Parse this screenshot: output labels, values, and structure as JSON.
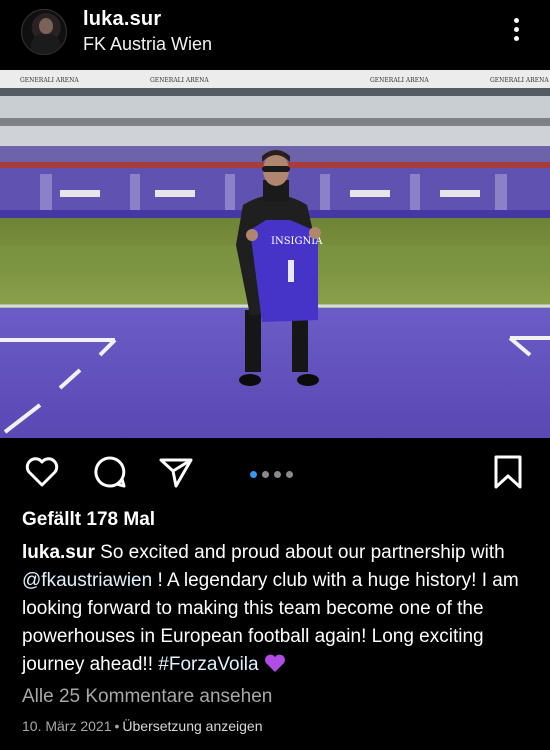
{
  "post": {
    "username": "luka.sur",
    "location": "FK Austria Wien",
    "likes": "Gefällt 178 Mal",
    "caption_user": "luka.sur",
    "caption_part1": " So excited and proud about our partnership with ",
    "mention": "@fkaustriawien",
    "caption_part2": " ! A legendary club with a huge history! I am looking forward to making this team become one of the powerhouses in European football again! Long exciting journey ahead!! ",
    "hashtag": "#ForzaVoila",
    "view_comments": "Alle 25 Kommentare ansehen",
    "date": "10. März 2021",
    "separator": "•",
    "translate": "Übersetzung anzeigen"
  },
  "carousel": {
    "count": 4,
    "active_index": 0
  },
  "photo": {
    "banner_texts": [
      "GENERALI ARENA",
      "GENERALI ARENA",
      "GENERALI ARENA",
      "GENERALI ARENA"
    ],
    "jersey_text": "INSIGNIA",
    "jersey_number": "1"
  },
  "icons": {
    "like": "heart-outline-icon",
    "comment": "comment-bubble-icon",
    "share": "paper-plane-icon",
    "save": "bookmark-icon",
    "more": "more-vertical-icon",
    "emoji": "purple-heart-emoji"
  },
  "colors": {
    "background": "#000000",
    "text": "#ffffff",
    "muted": "#a8a8a8",
    "accent_dot": "#3897f0",
    "pitch_purple": "#6a58c0",
    "grass": "#6f8a3a",
    "emoji_purple": "#b04de6"
  }
}
